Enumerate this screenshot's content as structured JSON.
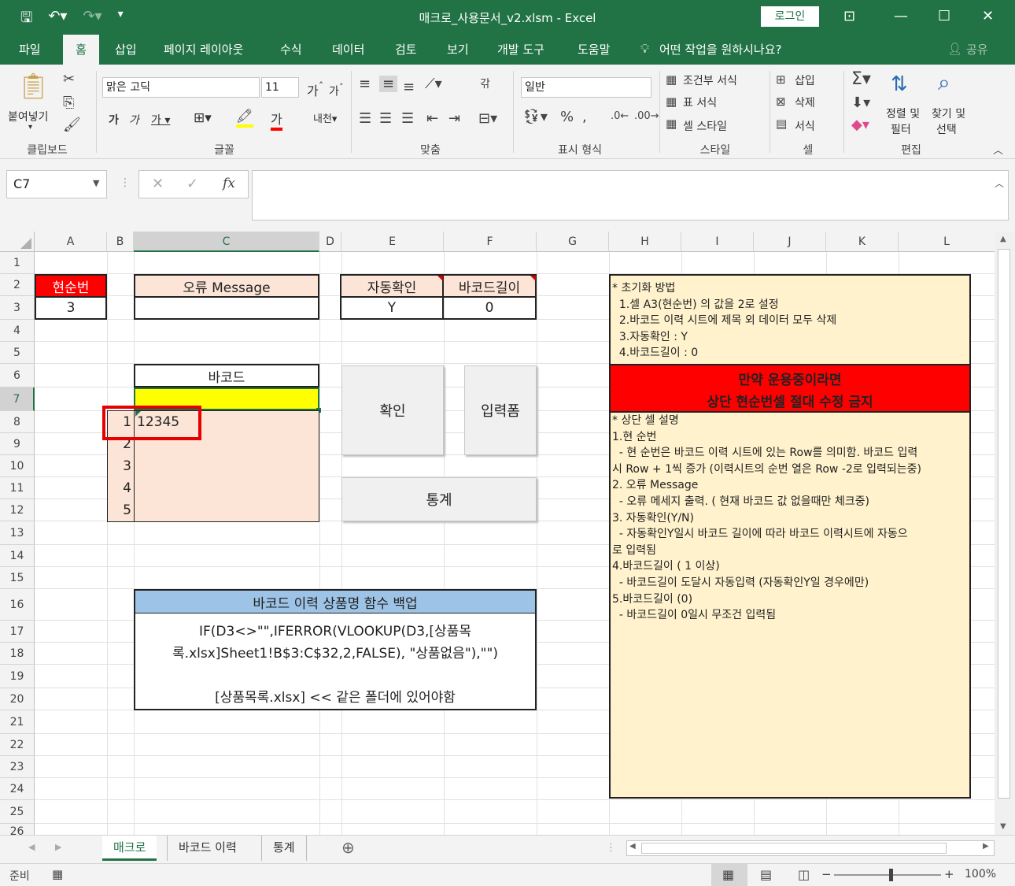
{
  "window": {
    "title": "매크로_사용문서_v2.xlsm  -  Excel",
    "login": "로그인"
  },
  "menu": {
    "tabs": [
      "파일",
      "홈",
      "삽입",
      "페이지 레이아웃",
      "수식",
      "데이터",
      "검토",
      "보기",
      "개발 도구",
      "도움말"
    ],
    "tell_me": "어떤 작업을 원하시나요?",
    "share": "공유"
  },
  "ribbon": {
    "paste": "붙여넣기",
    "font_name": "맑은 고딕",
    "font_size": "11",
    "number_format": "일반",
    "cond_format": "조건부 서식",
    "table_format": "표 서식",
    "cell_style": "셀 스타일",
    "insert": "삽입",
    "delete": "삭제",
    "format": "서식",
    "sort_filter_1": "정렬 및",
    "sort_filter_2": "필터",
    "find_select_1": "찾기 및",
    "find_select_2": "선택",
    "groups": [
      "클립보드",
      "글꼴",
      "맞춤",
      "표시 형식",
      "스타일",
      "셀",
      "편집"
    ]
  },
  "formula_bar": {
    "name_box": "C7",
    "formula": ""
  },
  "sheet": {
    "columns": [
      "A",
      "B",
      "C",
      "D",
      "E",
      "F",
      "G",
      "H",
      "I",
      "J",
      "K",
      "L"
    ],
    "rows": [
      "1",
      "2",
      "3",
      "4",
      "5",
      "6",
      "7",
      "8",
      "9",
      "10",
      "11",
      "12",
      "13",
      "14",
      "15",
      "16",
      "17",
      "18",
      "19",
      "20",
      "21",
      "22",
      "23",
      "24",
      "25",
      "26"
    ],
    "current_no_label": "현순번",
    "current_no_value": "3",
    "error_label": "오류 Message",
    "error_value": "",
    "auto_label": "자동확인",
    "auto_value": "Y",
    "len_label": "바코드길이",
    "len_value": "0",
    "barcode_label": "바코드",
    "seq": [
      "1",
      "2",
      "3",
      "4",
      "5"
    ],
    "barcode_first": "12345",
    "btn_confirm": "확인",
    "btn_form": "입력폼",
    "btn_stats": "통계",
    "backup_title": "바코드 이력 상품명 함수 백업",
    "backup_line1": "IF(D3<>\"\",IFERROR(VLOOKUP(D3,[상품목",
    "backup_line2": "록.xlsx]Sheet1!B$3:C$32,2,FALSE), \"상품없음\"),\"\")",
    "backup_line3": "[상품목록.xlsx] << 같은 폴더에 있어야함",
    "reset_note": "* 초기화 방법\n  1.셀 A3(현순번) 의 값을 2로 설정\n  2.바코드 이력 시트에 제목 외 데이터 모두 삭제\n  3.자동확인 : Y\n  4.바코드길이 : 0",
    "warning_line1": "만약 운용중이라면",
    "warning_line2": "상단 현순번셀 절대 수정 금지",
    "desc_note": "* 상단 셀 설명\n1.현 순번\n  - 현 순번은 바코드 이력 시트에 있는 Row를 의미함. 바코드 입력\n시 Row + 1씩 증가 (이력시트의 순번 열은 Row -2로 입력되는중)\n2. 오류 Message\n  - 오류 메세지 출력. ( 현재 바코드 값 없을때만 체크중)\n3. 자동확인(Y/N)\n  - 자동확인Y일시 바코드 길이에 따라 바코드 이력시트에 자동으\n로 입력됨\n4.바코드길이 ( 1 이상)\n  - 바코드길이 도달시 자동입력 (자동확인Y일 경우에만)\n5.바코드길이 (0)\n  - 바코드길이 0일시 무조건 입력됨"
  },
  "sheet_tabs": [
    "매크로",
    "바코드 이력",
    "통계"
  ],
  "status": {
    "ready": "준비",
    "zoom": "100%"
  },
  "colors": {
    "excel_green": "#217346",
    "header_red": "#ff0000",
    "peach": "#fce4d6",
    "yellow": "#ffff00",
    "note_bg": "#fff2cc",
    "blue_header": "#9dc3e6",
    "highlight_red": "#e60000"
  }
}
